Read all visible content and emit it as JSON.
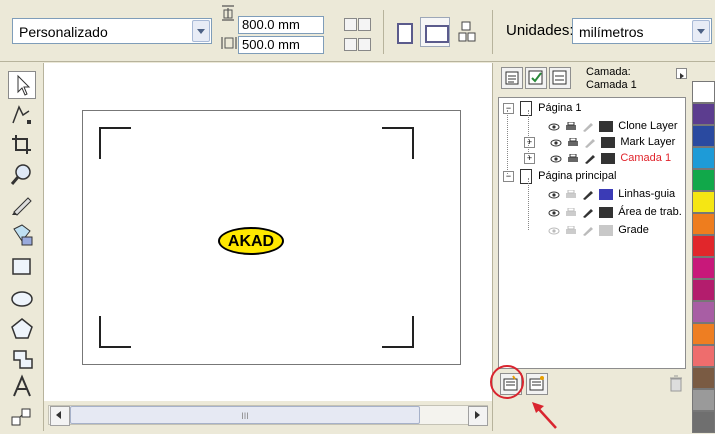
{
  "propbar": {
    "preset_value": "Personalizado",
    "width_value": "800.0 mm",
    "height_value": "500.0 mm",
    "units_label": "Unidades:",
    "units_value": "milímetros"
  },
  "toolbox": {
    "tools": [
      "pick-tool",
      "shape-tool",
      "crop-tool",
      "zoom-tool",
      "freehand-tool",
      "smart-fill-tool",
      "rectangle-tool",
      "ellipse-tool",
      "polygon-tool",
      "basic-shapes-tool",
      "text-tool",
      "interactive-blend-tool"
    ]
  },
  "canvas": {
    "logo_text": "AKAD"
  },
  "docker": {
    "header_label": "Camada:",
    "header_value": "Camada 1",
    "tree": [
      {
        "label": "Página 1",
        "level": 0,
        "type": "page"
      },
      {
        "label": "Clone Layer",
        "level": 1,
        "color": "#333333",
        "text_color": "#000000"
      },
      {
        "label": "Mark Layer",
        "level": 1,
        "color": "#333333",
        "text_color": "#000000"
      },
      {
        "label": "Camada 1",
        "level": 1,
        "color": "#333333",
        "text_color": "#e0242c"
      },
      {
        "label": "Página principal",
        "level": 0,
        "type": "page"
      },
      {
        "label": "Linhas-guia",
        "level": 1,
        "color": "#3b3bb6",
        "text_color": "#000000"
      },
      {
        "label": "Área de trab.",
        "level": 1,
        "color": "#333333",
        "text_color": "#000000"
      },
      {
        "label": "Grade",
        "level": 1,
        "color": "#c8c8c8",
        "text_color": "#000000"
      }
    ]
  },
  "scrollbar": {
    "thumb_grip": "III"
  },
  "palette": {
    "colors": [
      "#ffffff",
      "#5c3d8f",
      "#2a4aa0",
      "#1e9bd7",
      "#11a84a",
      "#f5e614",
      "#ee7d1e",
      "#e1262b",
      "#c8187a",
      "#b31d6d",
      "#a85ea4",
      "#ee7e22",
      "#ee6d6d",
      "#7a5b43",
      "#9a9a9a",
      "#6f6f6f"
    ]
  }
}
